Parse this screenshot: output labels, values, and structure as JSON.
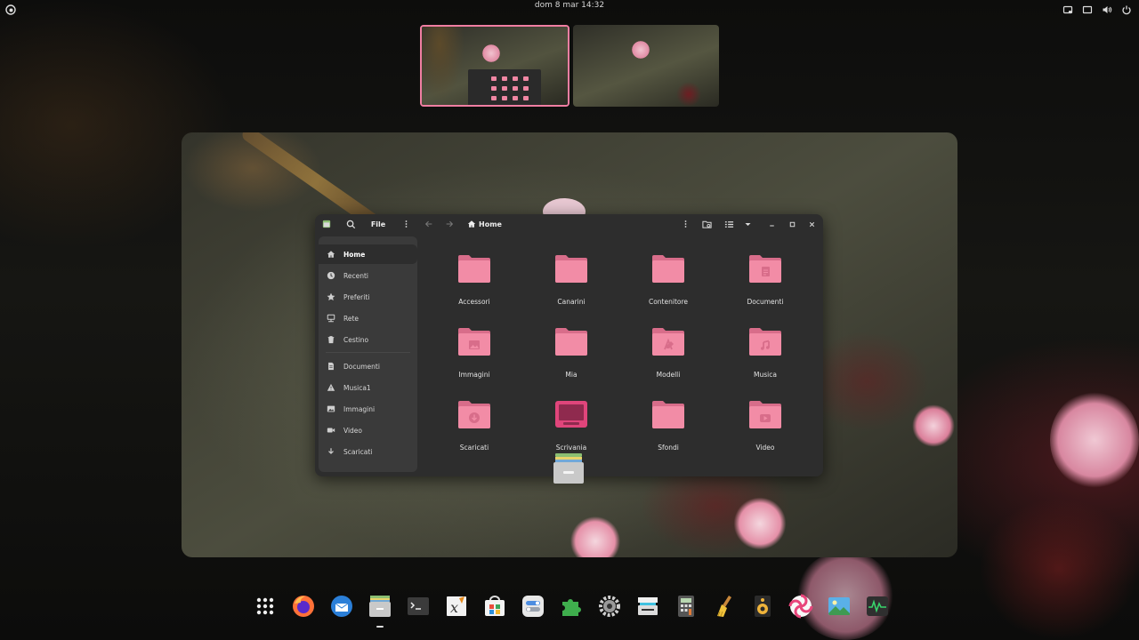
{
  "topbar": {
    "clock": "dom 8 mar  14:32",
    "activities_icon": "gnome-foot-icon",
    "status_icons": [
      "screen-share-icon",
      "display-icon",
      "volume-icon",
      "power-icon"
    ]
  },
  "workspaces": {
    "active_color": "#f07ea2",
    "items": [
      "workspace-1",
      "workspace-2"
    ]
  },
  "file_manager": {
    "header": {
      "app_icon": "files-app-icon",
      "search_icon": "search-icon",
      "title": "File",
      "menu_icon": "kebab-menu-icon",
      "back_icon": "arrow-left-icon",
      "forward_icon": "arrow-right-icon",
      "path_icon": "home-icon",
      "path": "Home",
      "view_menu_icon": "kebab-menu-icon",
      "search_folder_icon": "folder-search-icon",
      "list_view_icon": "list-view-icon",
      "dropdown_icon": "chevron-down-icon",
      "minimize_icon": "minimize-icon",
      "maximize_icon": "maximize-icon",
      "close_icon": "close-icon"
    },
    "sidebar": {
      "items": [
        {
          "label": "Home",
          "icon": "home-icon",
          "active": true
        },
        {
          "label": "Recenti",
          "icon": "clock-icon"
        },
        {
          "label": "Preferiti",
          "icon": "star-icon"
        },
        {
          "label": "Rete",
          "icon": "network-icon"
        },
        {
          "label": "Cestino",
          "icon": "trash-icon"
        },
        {
          "label": "Documenti",
          "icon": "document-icon"
        },
        {
          "label": "Musica1",
          "icon": "warning-icon"
        },
        {
          "label": "Immagini",
          "icon": "image-icon"
        },
        {
          "label": "Video",
          "icon": "video-icon"
        },
        {
          "label": "Scaricati",
          "icon": "download-icon"
        }
      ]
    },
    "folders": [
      {
        "label": "Accessori",
        "emblem": "none"
      },
      {
        "label": "Canarini",
        "emblem": "none"
      },
      {
        "label": "Contenitore",
        "emblem": "none"
      },
      {
        "label": "Documenti",
        "emblem": "document"
      },
      {
        "label": "Immagini",
        "emblem": "image"
      },
      {
        "label": "Mia",
        "emblem": "none"
      },
      {
        "label": "Modelli",
        "emblem": "template"
      },
      {
        "label": "Musica",
        "emblem": "music"
      },
      {
        "label": "Scaricati",
        "emblem": "download"
      },
      {
        "label": "Scrivania",
        "emblem": "desktop"
      },
      {
        "label": "Sfondi",
        "emblem": "none"
      },
      {
        "label": "Video",
        "emblem": "video"
      }
    ],
    "folder_color": "#f28ca6",
    "folder_tab_color": "#d86d8a"
  },
  "dock": {
    "items": [
      {
        "name": "app-grid-icon",
        "running": false
      },
      {
        "name": "firefox-icon",
        "running": false
      },
      {
        "name": "mail-client-icon",
        "running": false
      },
      {
        "name": "files-icon",
        "running": true
      },
      {
        "name": "terminal-icon",
        "running": false
      },
      {
        "name": "formula-editor-icon",
        "running": false
      },
      {
        "name": "software-store-icon",
        "running": false
      },
      {
        "name": "tweaks-icon",
        "running": false
      },
      {
        "name": "extensions-icon",
        "running": false
      },
      {
        "name": "settings-icon",
        "running": false
      },
      {
        "name": "scanner-icon",
        "running": false
      },
      {
        "name": "calculator-icon",
        "running": false
      },
      {
        "name": "cleaner-icon",
        "running": false
      },
      {
        "name": "speaker-icon",
        "running": false
      },
      {
        "name": "candy-icon",
        "running": false
      },
      {
        "name": "image-viewer-icon",
        "running": false
      },
      {
        "name": "system-monitor-icon",
        "running": false
      }
    ]
  }
}
